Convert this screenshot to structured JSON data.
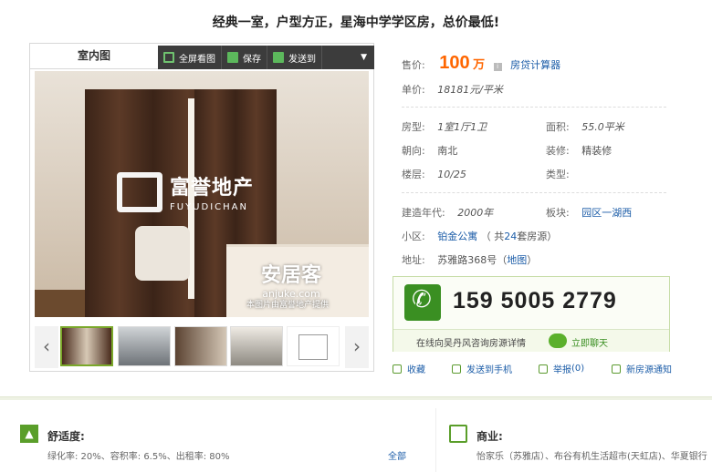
{
  "title": "经典一室，户型方正，星海中学学区房，总价最低!",
  "gallery": {
    "tab": "室内图",
    "toolbar": {
      "fullscreen": "全屏看图",
      "save": "保存",
      "send": "发送到"
    },
    "watermark": {
      "company": "富誉地产",
      "company_en": "FUYUDICHAN",
      "brand": "安居客",
      "url": "anjuke.com",
      "note": "本图片由富誉地产提供"
    }
  },
  "info": {
    "price_label": "售价:",
    "price_value": "100",
    "price_unit": "万",
    "calculator": "房贷计算器",
    "unit_price_label": "单价:",
    "unit_price": "18181元/平米",
    "layout_label": "房型:",
    "layout": "1室1厅1卫",
    "area_label": "面积:",
    "area": "55.0平米",
    "orientation_label": "朝向:",
    "orientation": "南北",
    "decoration_label": "装修:",
    "decoration": "精装修",
    "floor_label": "楼层:",
    "floor": "10/25",
    "type_label": "类型:",
    "type": "",
    "year_label": "建造年代:",
    "year": "2000年",
    "block_label": "板块:",
    "block": "园区一湖西",
    "community_label": "小区:",
    "community": "铂金公寓",
    "community_count_pre": "（ 共",
    "community_count": "24",
    "community_count_post": "套房源）",
    "address_label": "地址:",
    "address": "苏雅路368号（",
    "map_link": "地图",
    "address_end": "）"
  },
  "contact": {
    "phone": "159 5005 2779",
    "consult": "在线向吴丹风咨询房源详情",
    "chat": "立即聊天"
  },
  "actions": {
    "favorite": "收藏",
    "send_phone": "发送到手机",
    "report": "举报",
    "report_count": "(0)",
    "notify": "新房源通知"
  },
  "comfort": {
    "title": "舒适度:",
    "text": "绿化率: 20%、容积率: 6.5%、出租率: 80%",
    "all": "全部"
  },
  "commerce": {
    "title": "商业:",
    "text": "怡家乐（苏雅店）、布谷有机生活超市(天虹店)、华夏银行"
  }
}
